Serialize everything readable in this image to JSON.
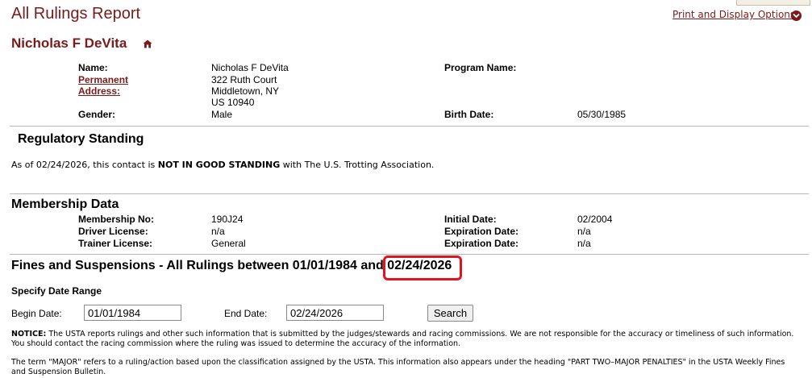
{
  "page": {
    "title": "All Rulings Report",
    "print_options": "Print and Display Options"
  },
  "person": {
    "name": "Nicholas F DeVita",
    "name_label": "Name:",
    "name_value": "Nicholas F DeVita",
    "permanent_label": "Permanent",
    "address_label": "Address:",
    "address_lines": [
      "322 Ruth Court",
      "Middletown, NY",
      "US 10940"
    ],
    "gender_label": "Gender:",
    "gender_value": "Male",
    "program_label": "Program Name:",
    "program_value": "",
    "birth_label": "Birth Date:",
    "birth_value": "05/30/1985"
  },
  "standing": {
    "heading": "Regulatory Standing",
    "prefix": "As of 02/24/2026, this contact is ",
    "status": "NOT IN GOOD STANDING",
    "suffix": " with The U.S. Trotting Association."
  },
  "membership": {
    "heading": "Membership Data",
    "rows": [
      {
        "label": "Membership No:",
        "value": "190J24",
        "label2": "Initial Date:",
        "value2": "02/2004"
      },
      {
        "label": "Driver License:",
        "value": "n/a",
        "label2": "Expiration Date:",
        "value2": "n/a"
      },
      {
        "label": "Trainer License:",
        "value": "General",
        "label2": "Expiration Date:",
        "value2": "n/a"
      }
    ]
  },
  "fines": {
    "heading_prefix": "Fines and Suspensions - All Rulings between 01/01/1984 and",
    "heading_end_date": "02/24/2026",
    "specify_label": "Specify Date Range",
    "begin_label": "Begin Date:",
    "begin_value": "01/01/1984",
    "end_label": "End Date:",
    "end_value": "02/24/2026",
    "search_label": "Search"
  },
  "notices": {
    "notice_label": "NOTICE:",
    "notice_text": " The USTA reports rulings and other such information that is submitted by the judges/stewards and racing commissions. We are not responsible for the accuracy or timeliness of such information. You should contact the racing commission where the ruling was issued to determine the accuracy of the information.",
    "major_text": "The term \"MAJOR\" refers to a ruling/action based upon the classification assigned by the USTA. This information also appears under the heading \"PART TWO–MAJOR PENALTIES\" in the USTA Weekly Fines and Suspension Bulletin."
  },
  "colors": {
    "accent": "#7a1a1a",
    "highlight": "#e0141e"
  },
  "icons": {
    "home": "home-icon",
    "print_menu": "chevron-down-icon"
  }
}
